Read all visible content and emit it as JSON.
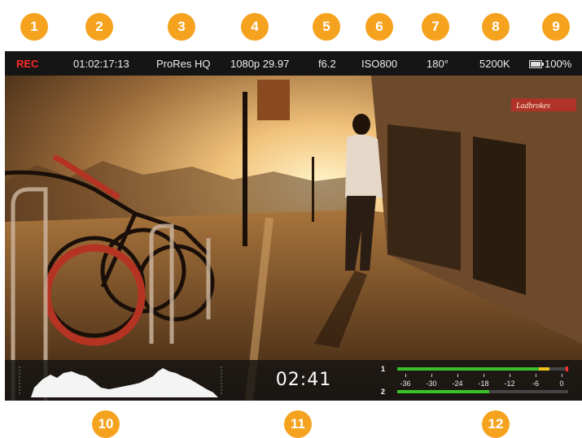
{
  "callouts": {
    "top": [
      "1",
      "2",
      "3",
      "4",
      "5",
      "6",
      "7",
      "8",
      "9"
    ],
    "bottom": [
      "10",
      "11",
      "12"
    ]
  },
  "status": {
    "rec": "REC",
    "timecode": "01:02:17:13",
    "codec": "ProRes HQ",
    "format": "1080p 29.97",
    "iris": "f6.2",
    "iso": "ISO800",
    "shutter": "180°",
    "white_balance": "5200K",
    "battery": "100%"
  },
  "bottom": {
    "remaining_time": "02:41"
  },
  "audio": {
    "channel1_label": "1",
    "channel2_label": "2",
    "scale": [
      "-36",
      "-30",
      "-24",
      "-18",
      "-12",
      "-6",
      "0"
    ],
    "channel1_level": 0.83,
    "channel1_peak": 0.89,
    "channel2_level": 0.54
  },
  "colors": {
    "accent": "#f5a31f",
    "rec": "#ff2a2a",
    "meter_green": "#39c12a",
    "meter_yellow": "#f0c21a"
  },
  "scene_sign": "Ladbrokes"
}
